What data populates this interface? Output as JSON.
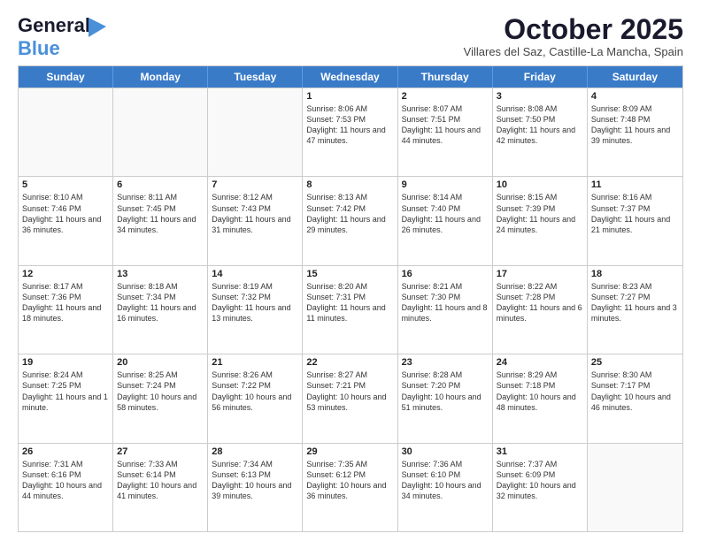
{
  "header": {
    "logo_general": "General",
    "logo_blue": "Blue",
    "month_title": "October 2025",
    "subtitle": "Villares del Saz, Castille-La Mancha, Spain"
  },
  "days_of_week": [
    "Sunday",
    "Monday",
    "Tuesday",
    "Wednesday",
    "Thursday",
    "Friday",
    "Saturday"
  ],
  "weeks": [
    {
      "cells": [
        {
          "day": "",
          "sunrise": "",
          "sunset": "",
          "daylight": ""
        },
        {
          "day": "",
          "sunrise": "",
          "sunset": "",
          "daylight": ""
        },
        {
          "day": "",
          "sunrise": "",
          "sunset": "",
          "daylight": ""
        },
        {
          "day": "1",
          "sunrise": "Sunrise: 8:06 AM",
          "sunset": "Sunset: 7:53 PM",
          "daylight": "Daylight: 11 hours and 47 minutes."
        },
        {
          "day": "2",
          "sunrise": "Sunrise: 8:07 AM",
          "sunset": "Sunset: 7:51 PM",
          "daylight": "Daylight: 11 hours and 44 minutes."
        },
        {
          "day": "3",
          "sunrise": "Sunrise: 8:08 AM",
          "sunset": "Sunset: 7:50 PM",
          "daylight": "Daylight: 11 hours and 42 minutes."
        },
        {
          "day": "4",
          "sunrise": "Sunrise: 8:09 AM",
          "sunset": "Sunset: 7:48 PM",
          "daylight": "Daylight: 11 hours and 39 minutes."
        }
      ]
    },
    {
      "cells": [
        {
          "day": "5",
          "sunrise": "Sunrise: 8:10 AM",
          "sunset": "Sunset: 7:46 PM",
          "daylight": "Daylight: 11 hours and 36 minutes."
        },
        {
          "day": "6",
          "sunrise": "Sunrise: 8:11 AM",
          "sunset": "Sunset: 7:45 PM",
          "daylight": "Daylight: 11 hours and 34 minutes."
        },
        {
          "day": "7",
          "sunrise": "Sunrise: 8:12 AM",
          "sunset": "Sunset: 7:43 PM",
          "daylight": "Daylight: 11 hours and 31 minutes."
        },
        {
          "day": "8",
          "sunrise": "Sunrise: 8:13 AM",
          "sunset": "Sunset: 7:42 PM",
          "daylight": "Daylight: 11 hours and 29 minutes."
        },
        {
          "day": "9",
          "sunrise": "Sunrise: 8:14 AM",
          "sunset": "Sunset: 7:40 PM",
          "daylight": "Daylight: 11 hours and 26 minutes."
        },
        {
          "day": "10",
          "sunrise": "Sunrise: 8:15 AM",
          "sunset": "Sunset: 7:39 PM",
          "daylight": "Daylight: 11 hours and 24 minutes."
        },
        {
          "day": "11",
          "sunrise": "Sunrise: 8:16 AM",
          "sunset": "Sunset: 7:37 PM",
          "daylight": "Daylight: 11 hours and 21 minutes."
        }
      ]
    },
    {
      "cells": [
        {
          "day": "12",
          "sunrise": "Sunrise: 8:17 AM",
          "sunset": "Sunset: 7:36 PM",
          "daylight": "Daylight: 11 hours and 18 minutes."
        },
        {
          "day": "13",
          "sunrise": "Sunrise: 8:18 AM",
          "sunset": "Sunset: 7:34 PM",
          "daylight": "Daylight: 11 hours and 16 minutes."
        },
        {
          "day": "14",
          "sunrise": "Sunrise: 8:19 AM",
          "sunset": "Sunset: 7:32 PM",
          "daylight": "Daylight: 11 hours and 13 minutes."
        },
        {
          "day": "15",
          "sunrise": "Sunrise: 8:20 AM",
          "sunset": "Sunset: 7:31 PM",
          "daylight": "Daylight: 11 hours and 11 minutes."
        },
        {
          "day": "16",
          "sunrise": "Sunrise: 8:21 AM",
          "sunset": "Sunset: 7:30 PM",
          "daylight": "Daylight: 11 hours and 8 minutes."
        },
        {
          "day": "17",
          "sunrise": "Sunrise: 8:22 AM",
          "sunset": "Sunset: 7:28 PM",
          "daylight": "Daylight: 11 hours and 6 minutes."
        },
        {
          "day": "18",
          "sunrise": "Sunrise: 8:23 AM",
          "sunset": "Sunset: 7:27 PM",
          "daylight": "Daylight: 11 hours and 3 minutes."
        }
      ]
    },
    {
      "cells": [
        {
          "day": "19",
          "sunrise": "Sunrise: 8:24 AM",
          "sunset": "Sunset: 7:25 PM",
          "daylight": "Daylight: 11 hours and 1 minute."
        },
        {
          "day": "20",
          "sunrise": "Sunrise: 8:25 AM",
          "sunset": "Sunset: 7:24 PM",
          "daylight": "Daylight: 10 hours and 58 minutes."
        },
        {
          "day": "21",
          "sunrise": "Sunrise: 8:26 AM",
          "sunset": "Sunset: 7:22 PM",
          "daylight": "Daylight: 10 hours and 56 minutes."
        },
        {
          "day": "22",
          "sunrise": "Sunrise: 8:27 AM",
          "sunset": "Sunset: 7:21 PM",
          "daylight": "Daylight: 10 hours and 53 minutes."
        },
        {
          "day": "23",
          "sunrise": "Sunrise: 8:28 AM",
          "sunset": "Sunset: 7:20 PM",
          "daylight": "Daylight: 10 hours and 51 minutes."
        },
        {
          "day": "24",
          "sunrise": "Sunrise: 8:29 AM",
          "sunset": "Sunset: 7:18 PM",
          "daylight": "Daylight: 10 hours and 48 minutes."
        },
        {
          "day": "25",
          "sunrise": "Sunrise: 8:30 AM",
          "sunset": "Sunset: 7:17 PM",
          "daylight": "Daylight: 10 hours and 46 minutes."
        }
      ]
    },
    {
      "cells": [
        {
          "day": "26",
          "sunrise": "Sunrise: 7:31 AM",
          "sunset": "Sunset: 6:16 PM",
          "daylight": "Daylight: 10 hours and 44 minutes."
        },
        {
          "day": "27",
          "sunrise": "Sunrise: 7:33 AM",
          "sunset": "Sunset: 6:14 PM",
          "daylight": "Daylight: 10 hours and 41 minutes."
        },
        {
          "day": "28",
          "sunrise": "Sunrise: 7:34 AM",
          "sunset": "Sunset: 6:13 PM",
          "daylight": "Daylight: 10 hours and 39 minutes."
        },
        {
          "day": "29",
          "sunrise": "Sunrise: 7:35 AM",
          "sunset": "Sunset: 6:12 PM",
          "daylight": "Daylight: 10 hours and 36 minutes."
        },
        {
          "day": "30",
          "sunrise": "Sunrise: 7:36 AM",
          "sunset": "Sunset: 6:10 PM",
          "daylight": "Daylight: 10 hours and 34 minutes."
        },
        {
          "day": "31",
          "sunrise": "Sunrise: 7:37 AM",
          "sunset": "Sunset: 6:09 PM",
          "daylight": "Daylight: 10 hours and 32 minutes."
        },
        {
          "day": "",
          "sunrise": "",
          "sunset": "",
          "daylight": ""
        }
      ]
    }
  ]
}
